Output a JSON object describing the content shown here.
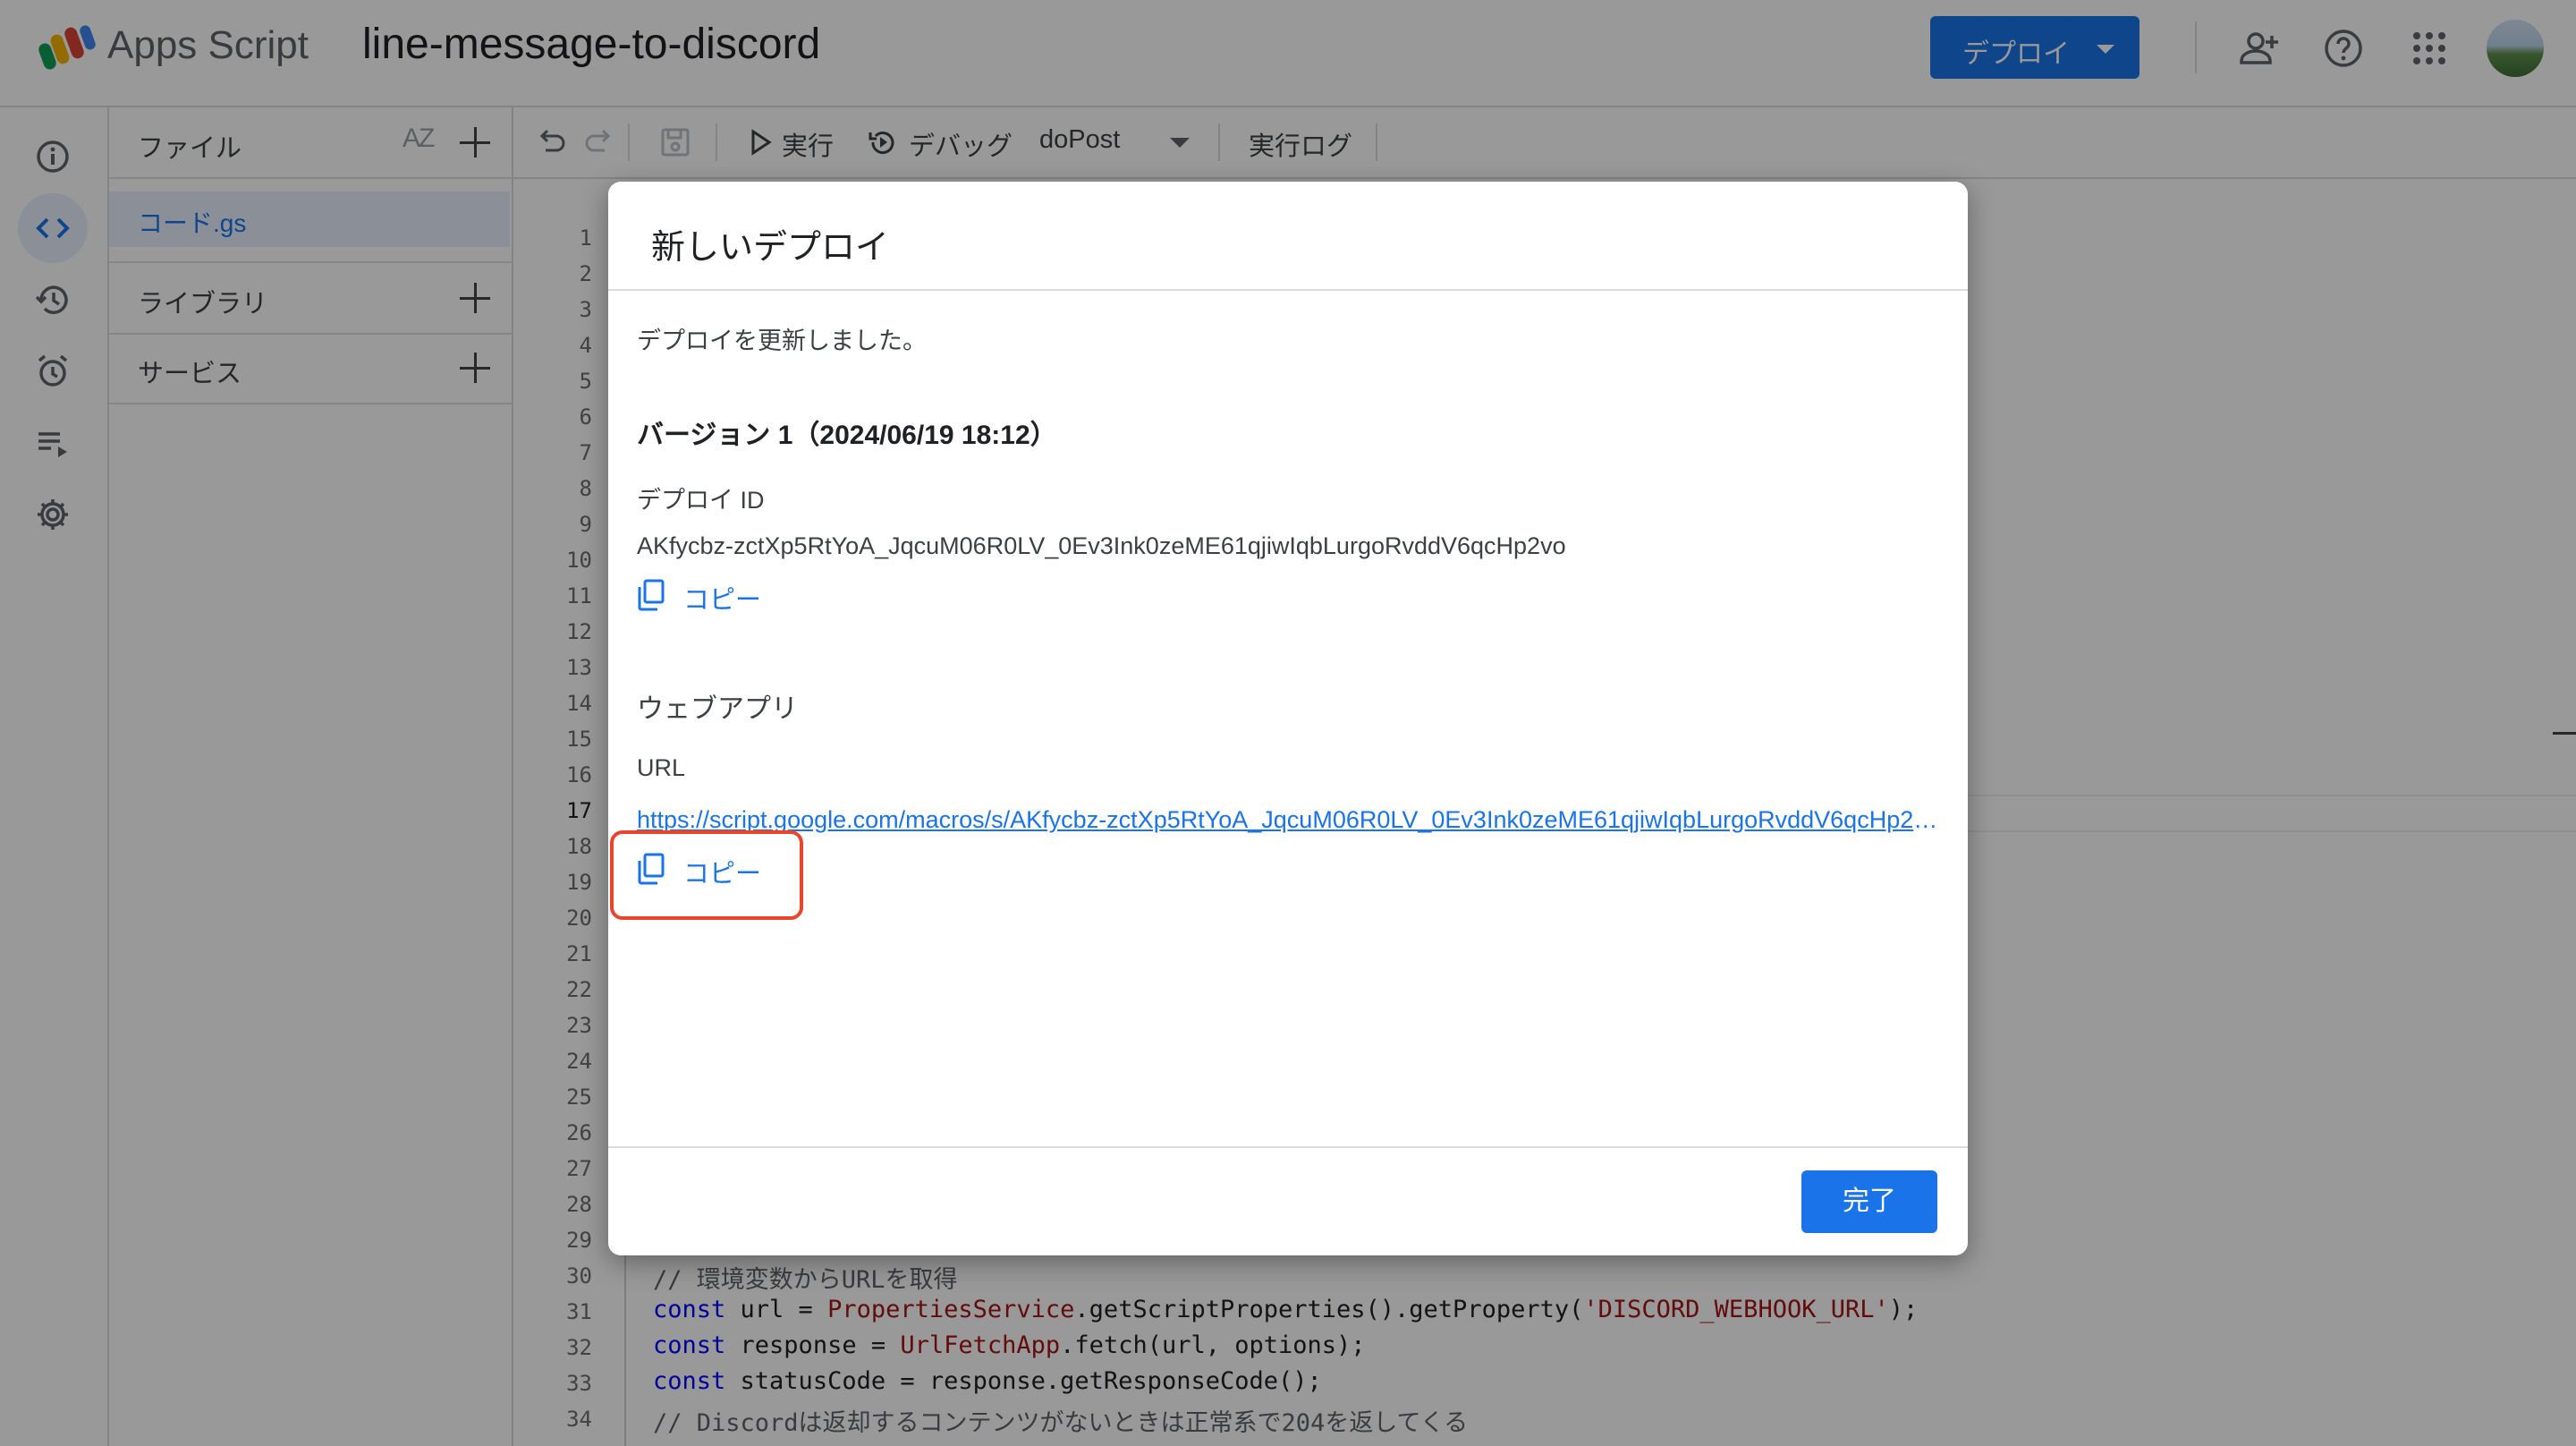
{
  "header": {
    "app_name": "Apps Script",
    "project_title": "line-message-to-discord",
    "deploy_button_label": "デプロイ"
  },
  "files_panel": {
    "title": "ファイル",
    "sort_label": "AZ",
    "file": "コード.gs",
    "libraries": "ライブラリ",
    "services": "サービス"
  },
  "toolbar": {
    "run": "実行",
    "debug": "デバッグ",
    "function": "doPost",
    "log": "実行ログ"
  },
  "editor": {
    "line_numbers": [
      "1",
      "2",
      "3",
      "4",
      "5",
      "6",
      "7",
      "8",
      "9",
      "10",
      "11",
      "12",
      "13",
      "14",
      "15",
      "16",
      "17",
      "18",
      "19",
      "20",
      "21",
      "22",
      "23",
      "24",
      "25",
      "26",
      "27",
      "28",
      "29",
      "30",
      "31",
      "32",
      "33",
      "34"
    ],
    "current_line": "17",
    "code_30": "// 環境変数からURLを取得",
    "code_31_kw": "const",
    "code_31_a": " url = ",
    "code_31_cls": "PropertiesService",
    "code_31_b": ".getScriptProperties().getProperty(",
    "code_31_str": "'DISCORD_WEBHOOK_URL'",
    "code_31_c": ");",
    "code_32_kw": "const",
    "code_32_a": " response = ",
    "code_32_cls": "UrlFetchApp",
    "code_32_b": ".fetch(url, options);",
    "code_33_kw": "const",
    "code_33_a": " statusCode = response.getResponseCode();",
    "code_34": "// Discordは返却するコンテンツがないときは正常系で204を返してくる"
  },
  "dialog": {
    "title": "新しいデプロイ",
    "message": "デプロイを更新しました。",
    "version": "バージョン 1（2024/06/19 18:12）",
    "deploy_id_label": "デプロイ ID",
    "deploy_id": "AKfycbz-zctXp5RtYoA_JqcuM06R0LV_0Ev3Ink0zeME61qjiwIqbLurgoRvddV6qcHp2vo",
    "copy_label": "コピー",
    "webapp_label": "ウェブアプリ",
    "url_label": "URL",
    "url": "https://script.google.com/macros/s/AKfycbz-zctXp5RtYoA_JqcuM06R0LV_0Ev3Ink0zeME61qjiwIqbLurgoRvddV6qcHp2v…",
    "done_label": "完了"
  },
  "colors": {
    "accent": "#1a73e8",
    "highlight": "#e8452c"
  }
}
